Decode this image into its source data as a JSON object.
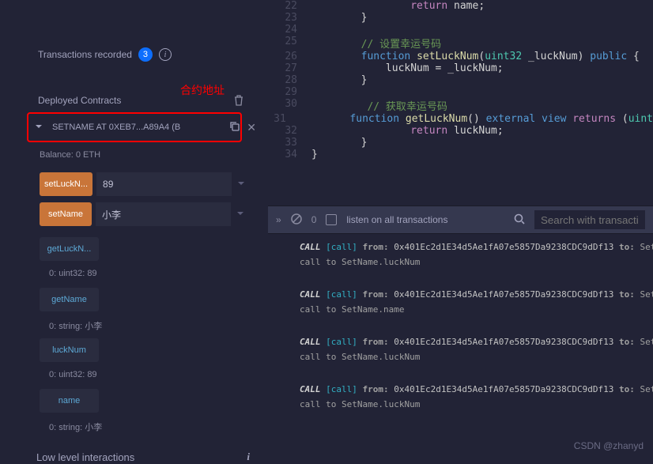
{
  "sidebar": {
    "transactions_label": "Transactions recorded",
    "transactions_count": "3",
    "red_annotation": "合约地址",
    "deployed_label": "Deployed Contracts",
    "contract_header": "SETNAME AT 0XEB7...A89A4 (B",
    "balance": "Balance: 0 ETH",
    "functions": {
      "setLuckNum": {
        "label": "setLuckN...",
        "value": "89"
      },
      "setName": {
        "label": "setName",
        "value": "小李"
      },
      "getLuckNum": {
        "label": "getLuckN..."
      },
      "getLuckNum_result": "0: uint32: 89",
      "getName": {
        "label": "getName"
      },
      "getName_result": "0: string: 小李",
      "luckNum": {
        "label": "luckNum"
      },
      "luckNum_result": "0: uint32: 89",
      "name": {
        "label": "name"
      },
      "name_result": "0: string: 小李"
    },
    "low_level": "Low level interactions"
  },
  "editor": {
    "lines": [
      {
        "n": "22",
        "indent": "                ",
        "tokens": [
          {
            "c": "ret",
            "t": "return"
          },
          {
            "c": "",
            "t": " name;"
          }
        ]
      },
      {
        "n": "23",
        "indent": "        ",
        "tokens": [
          {
            "c": "",
            "t": "}"
          }
        ]
      },
      {
        "n": "24",
        "indent": "",
        "tokens": []
      },
      {
        "n": "25",
        "indent": "        ",
        "tokens": [
          {
            "c": "cmt",
            "t": "// 设置幸运号码"
          }
        ]
      },
      {
        "n": "26",
        "indent": "        ",
        "tokens": [
          {
            "c": "kw",
            "t": "function"
          },
          {
            "c": "",
            "t": " "
          },
          {
            "c": "fn",
            "t": "setLuckNum"
          },
          {
            "c": "",
            "t": "("
          },
          {
            "c": "typ",
            "t": "uint32"
          },
          {
            "c": "",
            "t": " _luckNum) "
          },
          {
            "c": "kw",
            "t": "public"
          },
          {
            "c": "",
            "t": " {"
          }
        ]
      },
      {
        "n": "27",
        "indent": "            ",
        "tokens": [
          {
            "c": "",
            "t": "luckNum = _luckNum;"
          }
        ]
      },
      {
        "n": "28",
        "indent": "        ",
        "tokens": [
          {
            "c": "",
            "t": "}"
          }
        ]
      },
      {
        "n": "29",
        "indent": "",
        "tokens": []
      },
      {
        "n": "30",
        "indent": "         ",
        "tokens": [
          {
            "c": "cmt",
            "t": "// 获取幸运号码"
          }
        ]
      },
      {
        "n": "31",
        "indent": "        ",
        "tokens": [
          {
            "c": "kw",
            "t": "function"
          },
          {
            "c": "",
            "t": " "
          },
          {
            "c": "fn",
            "t": "getLuckNum"
          },
          {
            "c": "",
            "t": "() "
          },
          {
            "c": "kw",
            "t": "external"
          },
          {
            "c": "",
            "t": " "
          },
          {
            "c": "kw",
            "t": "view"
          },
          {
            "c": "",
            "t": " "
          },
          {
            "c": "ret",
            "t": "returns"
          },
          {
            "c": "",
            "t": " ("
          },
          {
            "c": "typ",
            "t": "uint"
          }
        ]
      },
      {
        "n": "32",
        "indent": "                ",
        "tokens": [
          {
            "c": "ret",
            "t": "return"
          },
          {
            "c": "",
            "t": " luckNum;"
          }
        ]
      },
      {
        "n": "33",
        "indent": "        ",
        "tokens": [
          {
            "c": "",
            "t": "}"
          }
        ]
      },
      {
        "n": "34",
        "indent": "",
        "tokens": [
          {
            "c": "",
            "t": "}"
          }
        ]
      }
    ]
  },
  "terminal": {
    "zero": "0",
    "listen": "listen on all transactions",
    "search_placeholder": "Search with transaction"
  },
  "console": {
    "logs": [
      {
        "bracket": "[call]",
        "from": "from:",
        "addr": "0x401Ec2d1E34d5Ae1fA07e5857Da9238CDC9dDf13",
        "to": "to:",
        "rest": "Set",
        "l2": "call to SetName.luckNum"
      },
      {
        "bracket": "[call]",
        "from": "from:",
        "addr": "0x401Ec2d1E34d5Ae1fA07e5857Da9238CDC9dDf13",
        "to": "to:",
        "rest": "Set",
        "l2": "call to SetName.name"
      },
      {
        "bracket": "[call]",
        "from": "from:",
        "addr": "0x401Ec2d1E34d5Ae1fA07e5857Da9238CDC9dDf13",
        "to": "to:",
        "rest": "Set",
        "l2": "call to SetName.luckNum"
      },
      {
        "bracket": "[call]",
        "from": "from:",
        "addr": "0x401Ec2d1E34d5Ae1fA07e5857Da9238CDC9dDf13",
        "to": "to:",
        "rest": "Set",
        "l2": "call to SetName.luckNum"
      }
    ],
    "call_word": "CALL"
  },
  "watermark": "CSDN @zhanyd"
}
